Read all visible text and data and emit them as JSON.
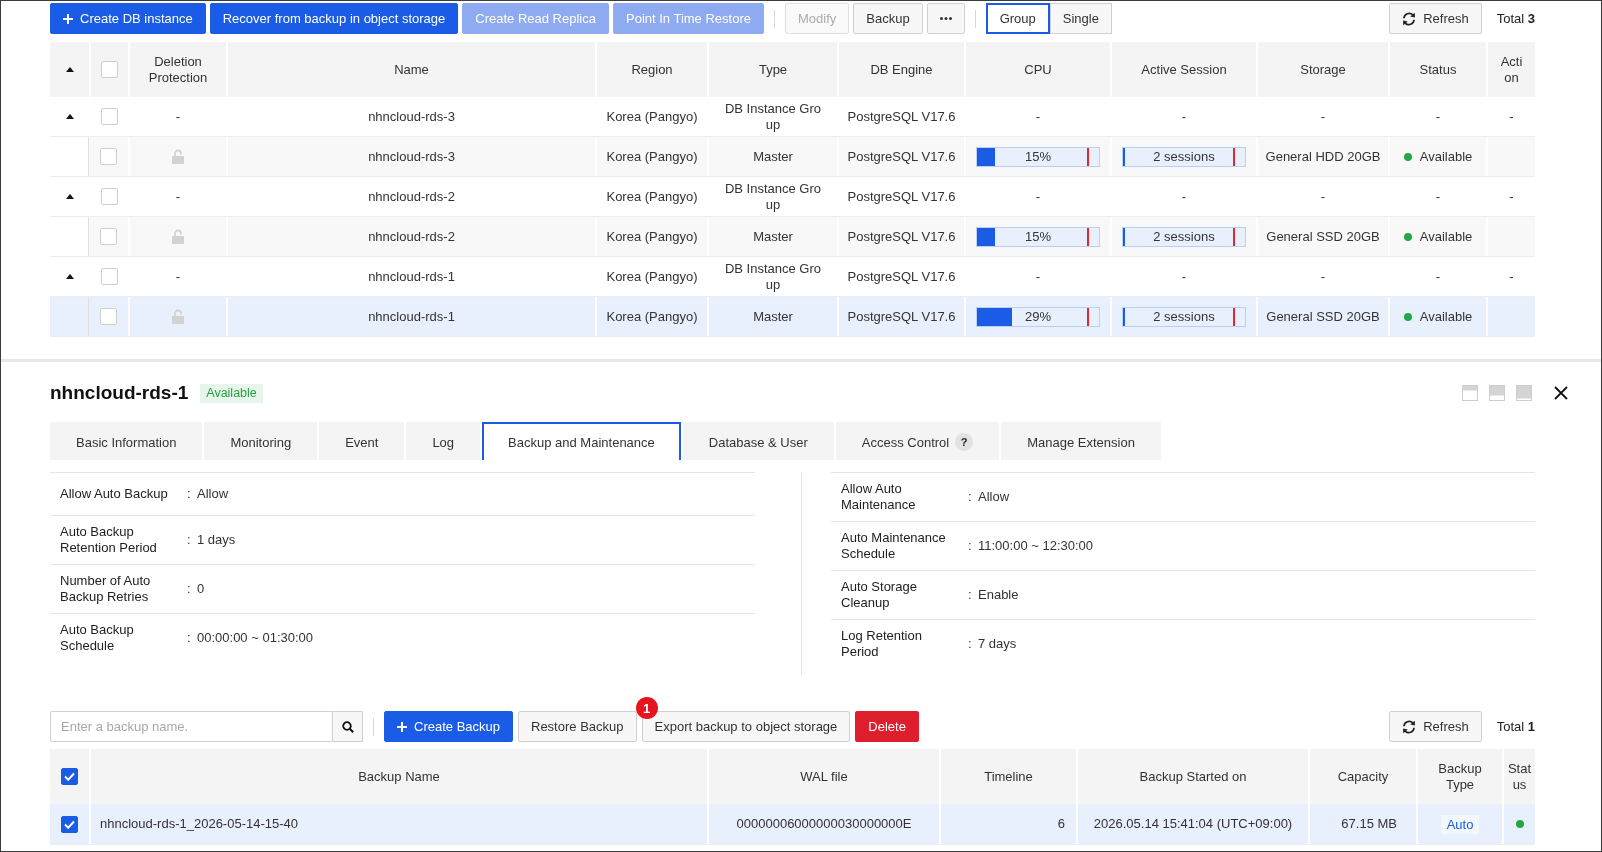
{
  "instance_toolbar": {
    "actions": [
      {
        "kind": "add",
        "label": "Create DB instance",
        "disabled": false
      },
      {
        "kind": "primary",
        "label": "Recover from backup in object storage",
        "disabled": false
      },
      {
        "kind": "primary",
        "label": "Create Read Replica",
        "disabled": true
      },
      {
        "kind": "primary",
        "label": "Point In Time Restore",
        "disabled": true
      }
    ],
    "more_actions": [
      {
        "kind": "default",
        "label": "Modify",
        "disabled": true
      },
      {
        "kind": "default",
        "label": "Backup",
        "disabled": false
      },
      {
        "kind": "more",
        "disabled": false
      }
    ],
    "view_modes": [
      {
        "label": "Group",
        "selected": true
      },
      {
        "label": "Single",
        "selected": false
      }
    ],
    "refresh": "Refresh",
    "total": "Total **3**"
  },
  "instances": {
    "header": {
      "expanded": true,
      "checked": false,
      "columns": [
        "Deletion Protection",
        "Name",
        "Region",
        "Type",
        "DB Engine",
        "CPU",
        "Active Session",
        "Storage",
        "Status",
        "Action"
      ]
    },
    "rows": [
      {
        "kind": "group",
        "expanded": true,
        "checked": false,
        "selected": false,
        "deletion_protection": "-",
        "name": "nhncloud-rds-3",
        "region": "Korea (Pangyo)",
        "type": "DB Instance Group",
        "engine": "PostgreSQL V17.6",
        "cpu": "-",
        "active_session": "-",
        "storage": "-",
        "status": "-",
        "action": "-"
      },
      {
        "kind": "instance",
        "checked": false,
        "selected": false,
        "protected": false,
        "name": "nhncloud-rds-3",
        "region": "Korea (Pangyo)",
        "type": "Master",
        "engine": "PostgreSQL V17.6",
        "cpu": {
          "level": 0.15,
          "reading": "15%"
        },
        "active_session": {
          "level": 0.02,
          "reading": "2 sessions"
        },
        "storage": "General HDD 20GB",
        "status": {
          "label": "Available",
          "color": "#22a846"
        }
      },
      {
        "kind": "group",
        "expanded": true,
        "checked": false,
        "selected": false,
        "deletion_protection": "-",
        "name": "nhncloud-rds-2",
        "region": "Korea (Pangyo)",
        "type": "DB Instance Group",
        "engine": "PostgreSQL V17.6",
        "cpu": "-",
        "active_session": "-",
        "storage": "-",
        "status": "-",
        "action": "-"
      },
      {
        "kind": "instance",
        "checked": false,
        "selected": false,
        "protected": false,
        "name": "nhncloud-rds-2",
        "region": "Korea (Pangyo)",
        "type": "Master",
        "engine": "PostgreSQL V17.6",
        "cpu": {
          "level": 0.15,
          "reading": "15%"
        },
        "active_session": {
          "level": 0.02,
          "reading": "2 sessions"
        },
        "storage": "General SSD 20GB",
        "status": {
          "label": "Available",
          "color": "#22a846"
        }
      },
      {
        "kind": "group",
        "expanded": true,
        "checked": false,
        "selected": false,
        "deletion_protection": "-",
        "name": "nhncloud-rds-1",
        "region": "Korea (Pangyo)",
        "type": "DB Instance Group",
        "engine": "PostgreSQL V17.6",
        "cpu": "-",
        "active_session": "-",
        "storage": "-",
        "status": "-",
        "action": "-"
      },
      {
        "kind": "instance",
        "checked": false,
        "selected": true,
        "protected": false,
        "name": "nhncloud-rds-1",
        "region": "Korea (Pangyo)",
        "type": "Master",
        "engine": "PostgreSQL V17.6",
        "cpu": {
          "level": 0.29,
          "reading": "29%"
        },
        "active_session": {
          "level": 0.02,
          "reading": "2 sessions"
        },
        "storage": "General SSD 20GB",
        "status": {
          "label": "Available",
          "color": "#22a846"
        }
      }
    ]
  },
  "detail": {
    "title": "nhncloud-rds-1",
    "status_badge": "Available",
    "tabs": [
      {
        "label": "Basic Information",
        "selected": false
      },
      {
        "label": "Monitoring",
        "selected": false
      },
      {
        "label": "Event",
        "selected": false
      },
      {
        "label": "Log",
        "selected": false
      },
      {
        "label": "Backup and Maintenance",
        "selected": true
      },
      {
        "label": "Database & User",
        "selected": false
      },
      {
        "label": "Access Control",
        "selected": false,
        "help": "?"
      },
      {
        "label": "Manage Extension",
        "selected": false
      }
    ],
    "backup_settings": [
      {
        "label": "Allow Auto Backup",
        "colon": ":",
        "value": "Allow"
      },
      {
        "label": "Auto Backup Retention Period",
        "colon": ":",
        "value": "1 days"
      },
      {
        "label": "Number of Auto Backup Retries",
        "colon": ":",
        "value": "0"
      },
      {
        "label": "Auto Backup Schedule",
        "colon": ":",
        "value": "00:00:00 ~ 01:30:00"
      }
    ],
    "maintenance_settings": [
      {
        "label": "Allow Auto Maintenance",
        "colon": ":",
        "value": "Allow"
      },
      {
        "label": "Auto Maintenance Schedule",
        "colon": ":",
        "value": "11:00:00 ~ 12:30:00"
      },
      {
        "label": "Auto Storage Cleanup",
        "colon": ":",
        "value": "Enable"
      },
      {
        "label": "Log Retention Period",
        "colon": ":",
        "value": "7 days"
      }
    ]
  },
  "backup_toolbar": {
    "search": {
      "placeholder": "Enter a backup name."
    },
    "actions": [
      {
        "kind": "add",
        "label": "Create Backup",
        "disabled": false
      },
      {
        "kind": "default",
        "label": "Restore Backup",
        "disabled": false
      },
      {
        "kind": "default",
        "label": "Export backup to object storage",
        "disabled": false,
        "callout": "1"
      },
      {
        "kind": "danger",
        "label": "Delete",
        "disabled": false
      }
    ],
    "refresh": "Refresh",
    "total": "Total **1**"
  },
  "backups": {
    "header": {
      "checked": true,
      "columns": [
        "Backup Name",
        "WAL file",
        "Timeline",
        "Backup Started on",
        "Capacity",
        "Backup Type",
        "Status"
      ]
    },
    "rows": [
      {
        "checked": true,
        "selected": true,
        "name": "nhncloud-rds-1_2026-05-14-15-40",
        "wal_file": "00000006000000030000000E",
        "timeline": "6",
        "started_on": "2026.05.14 15:41:04 (UTC+09:00)",
        "capacity": "67.15 MB",
        "backup_type": "Auto",
        "status": {
          "color": "#22a846"
        }
      }
    ]
  }
}
